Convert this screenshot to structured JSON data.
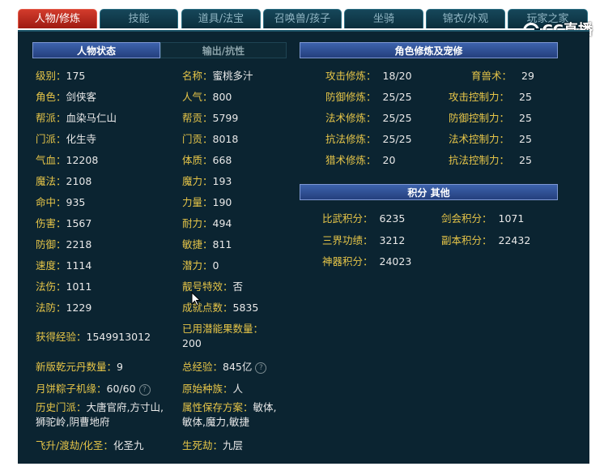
{
  "tabs": [
    "人物/修炼",
    "技能",
    "道具/法宝",
    "召唤兽/孩子",
    "坐骑",
    "锦衣/外观",
    "玩家之家"
  ],
  "watermark": "CC直播",
  "headers": {
    "status": "人物状态",
    "output": "输出/抗性",
    "cultivation": "角色修炼及宠修",
    "points": "积分 其他"
  },
  "left_col": [
    {
      "k": "级别：",
      "v": "175"
    },
    {
      "k": "角色：",
      "v": "剑侠客"
    },
    {
      "k": "帮派：",
      "v": "血染马仁山"
    },
    {
      "k": "门派：",
      "v": "化生寺"
    },
    {
      "k": "气血：",
      "v": "12208"
    },
    {
      "k": "魔法：",
      "v": "2108"
    },
    {
      "k": "命中：",
      "v": "935"
    },
    {
      "k": "伤害：",
      "v": "1567"
    },
    {
      "k": "防御：",
      "v": "2218"
    },
    {
      "k": "速度：",
      "v": "1114"
    },
    {
      "k": "法伤：",
      "v": "1011"
    },
    {
      "k": "法防：",
      "v": "1229"
    }
  ],
  "right_col": [
    {
      "k": "名称：",
      "v": "蜜桃多汁"
    },
    {
      "k": "人气：",
      "v": "800"
    },
    {
      "k": "帮贡：",
      "v": "5799"
    },
    {
      "k": "门贡：",
      "v": "8018"
    },
    {
      "k": "体质：",
      "v": "668"
    },
    {
      "k": "魔力：",
      "v": "193"
    },
    {
      "k": "力量：",
      "v": "190"
    },
    {
      "k": "耐力：",
      "v": "494"
    },
    {
      "k": "敏捷：",
      "v": "811"
    },
    {
      "k": "潜力：",
      "v": "0"
    },
    {
      "k": "靓号特效：",
      "v": "否"
    },
    {
      "k": "成就点数：",
      "v": "5835"
    }
  ],
  "extra": {
    "exp_k": "获得经验：",
    "exp_v": "1549913012",
    "used_k": "已用潜能果数量：",
    "used_v": "200",
    "qian_k": "新版乾元丹数量：",
    "qian_v": "9",
    "total_k": "总经验：",
    "total_v": "845亿",
    "moon_k": "月饼粽子机缘：",
    "moon_v": "60/60",
    "race_k": "原始种族：",
    "race_v": "人",
    "hist_k": "历史门派：",
    "hist_v": "大唐官府,方寸山,狮驼岭,阴曹地府",
    "attr_k": "属性保存方案：",
    "attr_v": "敏体,敏体,魔力,敏捷",
    "fly_k": "飞升/渡劫/化圣：",
    "fly_v": "化圣九",
    "life_k": "生死劫：",
    "life_v": "九层"
  },
  "cultivation": [
    {
      "k": "攻击修炼：",
      "v": "18/20",
      "k2": "育兽术：",
      "v2": "29"
    },
    {
      "k": "防御修炼：",
      "v": "25/25",
      "k2": "攻击控制力：",
      "v2": "25"
    },
    {
      "k": "法术修炼：",
      "v": "25/25",
      "k2": "防御控制力：",
      "v2": "25"
    },
    {
      "k": "抗法修炼：",
      "v": "25/25",
      "k2": "法术控制力：",
      "v2": "25"
    },
    {
      "k": "猎术修炼：",
      "v": "20",
      "k2": "抗法控制力：",
      "v2": "25"
    }
  ],
  "points": [
    {
      "k": "比武积分：",
      "v": "6235",
      "k2": "剑会积分：",
      "v2": "1071"
    },
    {
      "k": "三界功绩：",
      "v": "3212",
      "k2": "副本积分：",
      "v2": "22432"
    },
    {
      "k": "神器积分：",
      "v": "24023",
      "k2": "",
      "v2": ""
    }
  ]
}
